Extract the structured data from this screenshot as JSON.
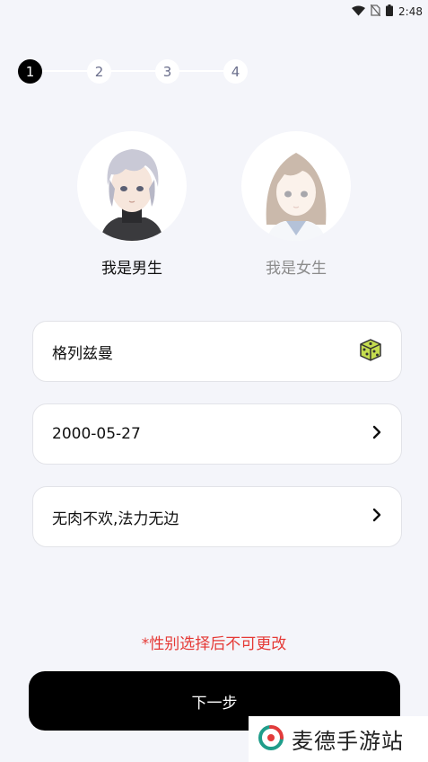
{
  "status_bar": {
    "time": "2:48"
  },
  "stepper": {
    "steps": [
      "1",
      "2",
      "3",
      "4"
    ],
    "current": 1
  },
  "gender": {
    "male_label": "我是男生",
    "female_label": "我是女生",
    "selected": "male"
  },
  "form": {
    "nickname": "格列兹曼",
    "birthday": "2000-05-27",
    "signature": "无肉不欢,法力无边"
  },
  "warning": "*性别选择后不可更改",
  "next_button": "下一步",
  "watermark": "麦德手游站"
}
